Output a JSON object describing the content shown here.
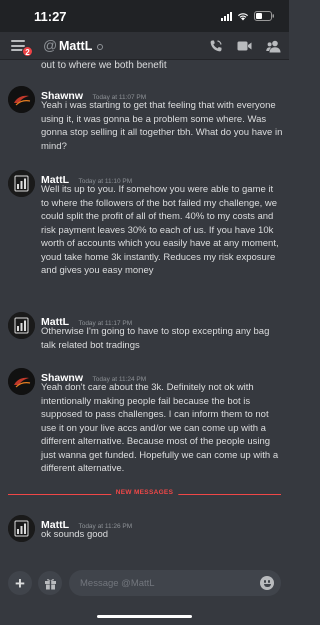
{
  "status_bar": {
    "time": "11:27"
  },
  "header": {
    "at_symbol": "@",
    "name": "MattL",
    "menu_badge": "2",
    "icons": [
      "menu-icon",
      "phone-icon",
      "video-icon",
      "members-icon"
    ]
  },
  "conversation": {
    "cutoff_text": "out to where we both benefit",
    "messages": [
      {
        "author": "Shawnw",
        "time": "Today at 11:07 PM",
        "text": "Yeah i was starting to get that feeling that with everyone using it, it was gonna be a problem some where. Was gonna stop selling it all together tbh. What do you have in mind?"
      },
      {
        "author": "MattL",
        "time": "Today at 11:10 PM",
        "text": "Well its up to you. If somehow you were able to game it to where the followers of the bot failed my challenge, we could split the profit of all of them. 40% to my costs and risk payment leaves 30% to each of us. If you have 10k worth of accounts which you easily have at any moment, youd take home 3k instantly. Reduces my risk exposure and gives you easy money"
      },
      {
        "author": "MattL",
        "time": "Today at 11:17 PM",
        "text": "Otherwise I'm going to have to stop excepting any bag talk related bot tradings"
      },
      {
        "author": "Shawnw",
        "time": "Today at 11:24 PM",
        "text": "Yeah don't care about the 3k. Definitely not ok with intentionally making people fail because the bot is supposed to pass challenges. I can inform them to not use it on your live accs and/or we can come up with a different alternative. Because most of the people using just wanna get funded. Hopefully we can come up with a different alternative."
      },
      {
        "author": "MattL",
        "time": "Today at 11:26 PM",
        "text": "ok sounds good"
      }
    ],
    "new_messages_label": "NEW MESSAGES"
  },
  "composer": {
    "placeholder": "Message @MattL",
    "buttons": [
      "plus-icon",
      "gift-icon",
      "emoji-icon"
    ]
  },
  "colors": {
    "background": "#36393f",
    "header": "#2f3136",
    "accent_red": "#f04747",
    "text": "#dcddde"
  }
}
